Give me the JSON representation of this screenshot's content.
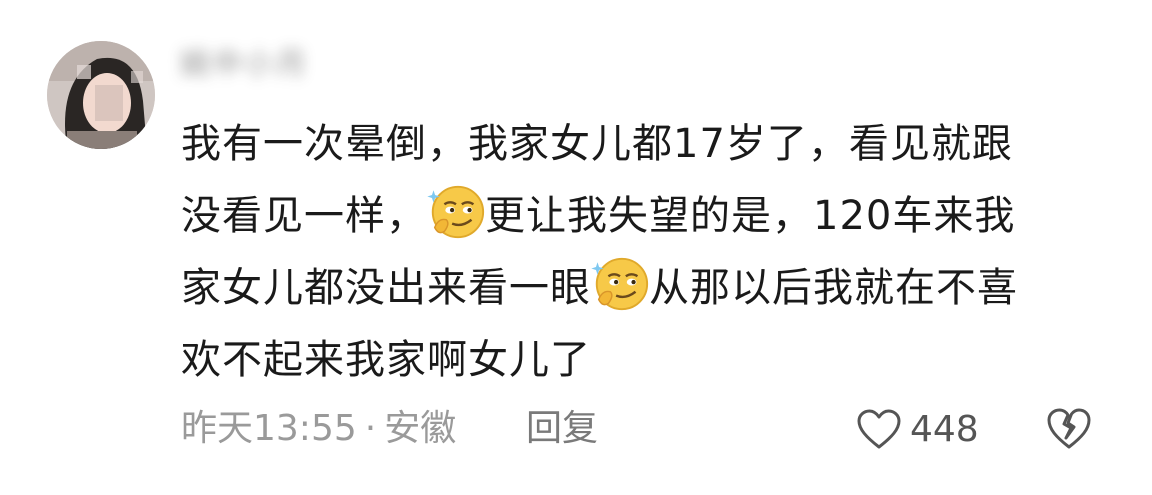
{
  "comment": {
    "username": "姚中小月",
    "lines": [
      "我有一次晕倒，我家女儿都17岁了，看见就跟",
      "没看见一样，",
      "更让我失望的是，120车来我",
      "家女儿都没出来看一眼",
      "从那以后我就在不喜",
      "欢不起来我家啊女儿了"
    ],
    "emoji_name": "smirk-thinking-emoji",
    "time": "昨天13:55",
    "separator": "·",
    "location": "安徽",
    "reply_label": "回复",
    "like_count": "448",
    "colors": {
      "text": "#1a1a1a",
      "meta": "#9a9a9a",
      "emoji_yellow": "#f7c948"
    }
  }
}
